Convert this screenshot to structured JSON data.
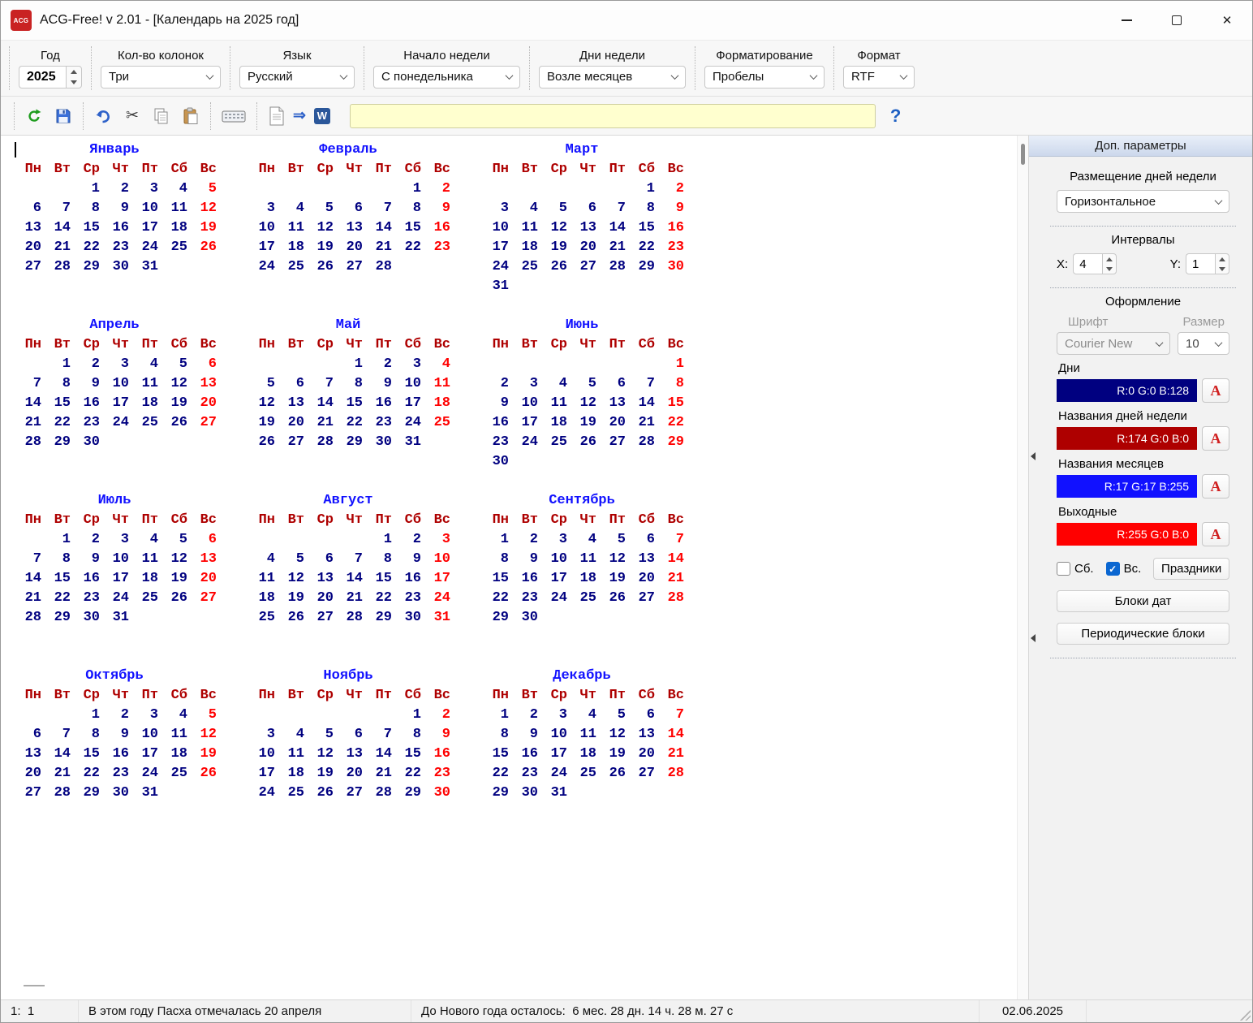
{
  "window": {
    "title": "ACG-Free! v 2.01 - [Календарь на 2025 год]",
    "logo_text": "ACG"
  },
  "icons": {
    "close": "✕",
    "cut": "✂",
    "arrow": "⇒",
    "word": "W",
    "help": "?"
  },
  "toolbar": {
    "fields": [
      {
        "label": "Год",
        "value": "2025"
      },
      {
        "label": "Кол-во колонок",
        "value": "Три"
      },
      {
        "label": "Язык",
        "value": "Русский"
      },
      {
        "label": "Начало недели",
        "value": "С понедельника"
      },
      {
        "label": "Дни недели",
        "value": "Возле месяцев"
      },
      {
        "label": "Форматирование",
        "value": "Пробелы"
      },
      {
        "label": "Формат",
        "value": "RTF"
      }
    ],
    "input_value": ""
  },
  "colors": {
    "days": "#000080",
    "weekday_names": "#AE0000",
    "month_names": "#1111FF",
    "weekends": "#FF0000"
  },
  "calendar": {
    "year": "2025",
    "weekday_headers": [
      "Пн",
      "Вт",
      "Ср",
      "Чт",
      "Пт",
      "Сб",
      "Вс"
    ],
    "months": [
      {
        "name": "Январь",
        "weeks": [
          [
            "",
            "",
            "1",
            "2",
            "3",
            "4",
            "5"
          ],
          [
            "6",
            "7",
            "8",
            "9",
            "10",
            "11",
            "12"
          ],
          [
            "13",
            "14",
            "15",
            "16",
            "17",
            "18",
            "19"
          ],
          [
            "20",
            "21",
            "22",
            "23",
            "24",
            "25",
            "26"
          ],
          [
            "27",
            "28",
            "29",
            "30",
            "31",
            "",
            ""
          ]
        ]
      },
      {
        "name": "Февраль",
        "weeks": [
          [
            "",
            "",
            "",
            "",
            "",
            "1",
            "2"
          ],
          [
            "3",
            "4",
            "5",
            "6",
            "7",
            "8",
            "9"
          ],
          [
            "10",
            "11",
            "12",
            "13",
            "14",
            "15",
            "16"
          ],
          [
            "17",
            "18",
            "19",
            "20",
            "21",
            "22",
            "23"
          ],
          [
            "24",
            "25",
            "26",
            "27",
            "28",
            "",
            ""
          ]
        ]
      },
      {
        "name": "Март",
        "weeks": [
          [
            "",
            "",
            "",
            "",
            "",
            "1",
            "2"
          ],
          [
            "3",
            "4",
            "5",
            "6",
            "7",
            "8",
            "9"
          ],
          [
            "10",
            "11",
            "12",
            "13",
            "14",
            "15",
            "16"
          ],
          [
            "17",
            "18",
            "19",
            "20",
            "21",
            "22",
            "23"
          ],
          [
            "24",
            "25",
            "26",
            "27",
            "28",
            "29",
            "30"
          ],
          [
            "31",
            "",
            "",
            "",
            "",
            "",
            ""
          ]
        ]
      },
      {
        "name": "Апрель",
        "weeks": [
          [
            "",
            "1",
            "2",
            "3",
            "4",
            "5",
            "6"
          ],
          [
            "7",
            "8",
            "9",
            "10",
            "11",
            "12",
            "13"
          ],
          [
            "14",
            "15",
            "16",
            "17",
            "18",
            "19",
            "20"
          ],
          [
            "21",
            "22",
            "23",
            "24",
            "25",
            "26",
            "27"
          ],
          [
            "28",
            "29",
            "30",
            "",
            "",
            "",
            ""
          ]
        ]
      },
      {
        "name": "Май",
        "weeks": [
          [
            "",
            "",
            "",
            "1",
            "2",
            "3",
            "4"
          ],
          [
            "5",
            "6",
            "7",
            "8",
            "9",
            "10",
            "11"
          ],
          [
            "12",
            "13",
            "14",
            "15",
            "16",
            "17",
            "18"
          ],
          [
            "19",
            "20",
            "21",
            "22",
            "23",
            "24",
            "25"
          ],
          [
            "26",
            "27",
            "28",
            "29",
            "30",
            "31",
            ""
          ]
        ]
      },
      {
        "name": "Июнь",
        "weeks": [
          [
            "",
            "",
            "",
            "",
            "",
            "",
            "1"
          ],
          [
            "2",
            "3",
            "4",
            "5",
            "6",
            "7",
            "8"
          ],
          [
            "9",
            "10",
            "11",
            "12",
            "13",
            "14",
            "15"
          ],
          [
            "16",
            "17",
            "18",
            "19",
            "20",
            "21",
            "22"
          ],
          [
            "23",
            "24",
            "25",
            "26",
            "27",
            "28",
            "29"
          ],
          [
            "30",
            "",
            "",
            "",
            "",
            "",
            ""
          ]
        ]
      },
      {
        "name": "Июль",
        "weeks": [
          [
            "",
            "1",
            "2",
            "3",
            "4",
            "5",
            "6"
          ],
          [
            "7",
            "8",
            "9",
            "10",
            "11",
            "12",
            "13"
          ],
          [
            "14",
            "15",
            "16",
            "17",
            "18",
            "19",
            "20"
          ],
          [
            "21",
            "22",
            "23",
            "24",
            "25",
            "26",
            "27"
          ],
          [
            "28",
            "29",
            "30",
            "31",
            "",
            "",
            ""
          ]
        ]
      },
      {
        "name": "Август",
        "weeks": [
          [
            "",
            "",
            "",
            "",
            "1",
            "2",
            "3"
          ],
          [
            "4",
            "5",
            "6",
            "7",
            "8",
            "9",
            "10"
          ],
          [
            "11",
            "12",
            "13",
            "14",
            "15",
            "16",
            "17"
          ],
          [
            "18",
            "19",
            "20",
            "21",
            "22",
            "23",
            "24"
          ],
          [
            "25",
            "26",
            "27",
            "28",
            "29",
            "30",
            "31"
          ]
        ]
      },
      {
        "name": "Сентябрь",
        "weeks": [
          [
            "1",
            "2",
            "3",
            "4",
            "5",
            "6",
            "7"
          ],
          [
            "8",
            "9",
            "10",
            "11",
            "12",
            "13",
            "14"
          ],
          [
            "15",
            "16",
            "17",
            "18",
            "19",
            "20",
            "21"
          ],
          [
            "22",
            "23",
            "24",
            "25",
            "26",
            "27",
            "28"
          ],
          [
            "29",
            "30",
            "",
            "",
            "",
            "",
            ""
          ]
        ]
      },
      {
        "name": "Октябрь",
        "weeks": [
          [
            "",
            "",
            "1",
            "2",
            "3",
            "4",
            "5"
          ],
          [
            "6",
            "7",
            "8",
            "9",
            "10",
            "11",
            "12"
          ],
          [
            "13",
            "14",
            "15",
            "16",
            "17",
            "18",
            "19"
          ],
          [
            "20",
            "21",
            "22",
            "23",
            "24",
            "25",
            "26"
          ],
          [
            "27",
            "28",
            "29",
            "30",
            "31",
            "",
            ""
          ]
        ]
      },
      {
        "name": "Ноябрь",
        "weeks": [
          [
            "",
            "",
            "",
            "",
            "",
            "1",
            "2"
          ],
          [
            "3",
            "4",
            "5",
            "6",
            "7",
            "8",
            "9"
          ],
          [
            "10",
            "11",
            "12",
            "13",
            "14",
            "15",
            "16"
          ],
          [
            "17",
            "18",
            "19",
            "20",
            "21",
            "22",
            "23"
          ],
          [
            "24",
            "25",
            "26",
            "27",
            "28",
            "29",
            "30"
          ]
        ]
      },
      {
        "name": "Декабрь",
        "weeks": [
          [
            "1",
            "2",
            "3",
            "4",
            "5",
            "6",
            "7"
          ],
          [
            "8",
            "9",
            "10",
            "11",
            "12",
            "13",
            "14"
          ],
          [
            "15",
            "16",
            "17",
            "18",
            "19",
            "20",
            "21"
          ],
          [
            "22",
            "23",
            "24",
            "25",
            "26",
            "27",
            "28"
          ],
          [
            "29",
            "30",
            "31",
            "",
            "",
            "",
            ""
          ]
        ]
      }
    ]
  },
  "sidebar": {
    "title": "Доп. параметры",
    "placement_label": "Размещение дней недели",
    "placement_value": "Горизонтальное",
    "intervals_label": "Интервалы",
    "x_label": "X:",
    "x_value": "4",
    "y_label": "Y:",
    "y_value": "1",
    "design_label": "Оформление",
    "font_label": "Шрифт",
    "size_label": "Размер",
    "font_value": "Courier New",
    "size_value": "10",
    "days_label": "Дни",
    "days_rgb": "R:0 G:0 B:128",
    "weekday_label": "Названия дней недели",
    "weekday_rgb": "R:174 G:0 B:0",
    "months_label": "Названия месяцев",
    "months_rgb": "R:17 G:17 B:255",
    "weekend_label": "Выходные",
    "weekend_rgb": "R:255 G:0 B:0",
    "sat_label": "Сб.",
    "sun_label": "Вс.",
    "holidays_button": "Праздники",
    "blocks_button": "Блоки дат",
    "periodic_button": "Периодические блоки",
    "a_label": "A"
  },
  "statusbar": {
    "position": "1:  1",
    "easter": "В этом году Пасха отмечалась 20 апреля",
    "countdown_label": "До Нового года осталось:",
    "countdown_value": "6 мес. 28 дн. 14 ч. 28 м. 27 с",
    "date": "02.06.2025"
  }
}
